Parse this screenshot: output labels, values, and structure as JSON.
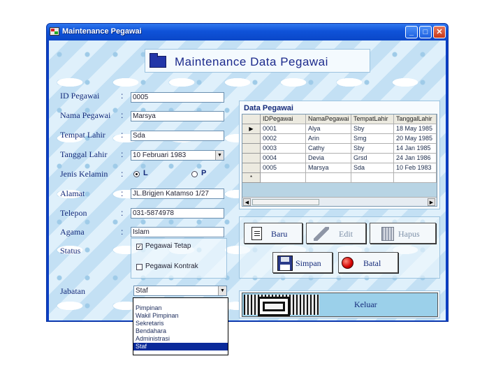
{
  "window": {
    "title": "Maintenance Pegawai",
    "minimize": "_",
    "maximize": "□",
    "close": "✕"
  },
  "header": {
    "title": "Maintenance Data Pegawai"
  },
  "form": {
    "colon": ":",
    "id_label": "ID Pegawai",
    "id_value": "0005",
    "nama_label": "Nama Pegawai",
    "nama_value": "Marsya",
    "tempat_label": "Tempat Lahir",
    "tempat_value": "Sda",
    "tanggal_label": "Tanggal Lahir",
    "tanggal_value": "10 Februari 1983",
    "jk_label": "Jenis Kelamin",
    "jk_l": "L",
    "jk_p": "P",
    "alamat_label": "Alamat",
    "alamat_value": "JL.Brigjen Katamso 1/27",
    "telepon_label": "Telepon",
    "telepon_value": "031-5874978",
    "agama_label": "Agama",
    "agama_value": "Islam",
    "status_label": "Status",
    "status_tetap": "Pegawai Tetap",
    "status_kontrak": "Pegawai Kontrak",
    "jabatan_label": "Jabatan",
    "jabatan_value": "Staf",
    "jabatan_options": [
      "Pimpinan",
      "Wakil Pimpinan",
      "Sekretaris",
      "Bendahara",
      "Administrasi",
      "Staf"
    ]
  },
  "grid": {
    "caption": "Data Pegawai",
    "columns": [
      "IDPegawai",
      "NamaPegawai",
      "TempatLahir",
      "TanggalLahir"
    ],
    "rows": [
      [
        "0001",
        "Alya",
        "Sby",
        "18 May 1985"
      ],
      [
        "0002",
        "Arin",
        "Smg",
        "20 May 1985"
      ],
      [
        "0003",
        "Cathy",
        "Sby",
        "14 Jan 1985"
      ],
      [
        "0004",
        "Devia",
        "Grsd",
        "24 Jan 1986"
      ],
      [
        "0005",
        "Marsya",
        "Sda",
        "10 Feb 1983"
      ]
    ],
    "current_marker": "▶",
    "new_marker": "*",
    "scroll_left": "◀",
    "scroll_right": "▶"
  },
  "buttons": {
    "baru": "Baru",
    "edit": "Edit",
    "hapus": "Hapus",
    "simpan": "Simpan",
    "batal": "Batal",
    "keluar": "Keluar"
  },
  "icons": {
    "app": "app-icon",
    "folder": "folder-icon",
    "baru": "document-icon",
    "edit": "pen-icon",
    "hapus": "trash-bin-icon",
    "simpan": "floppy-disk-icon",
    "batal": "stop-icon"
  },
  "colors": {
    "titlebar": "#0f52d8",
    "label_text": "#142a7a",
    "selected_item": "#0a2a9a",
    "keluar_button": "#9bd0ea"
  }
}
